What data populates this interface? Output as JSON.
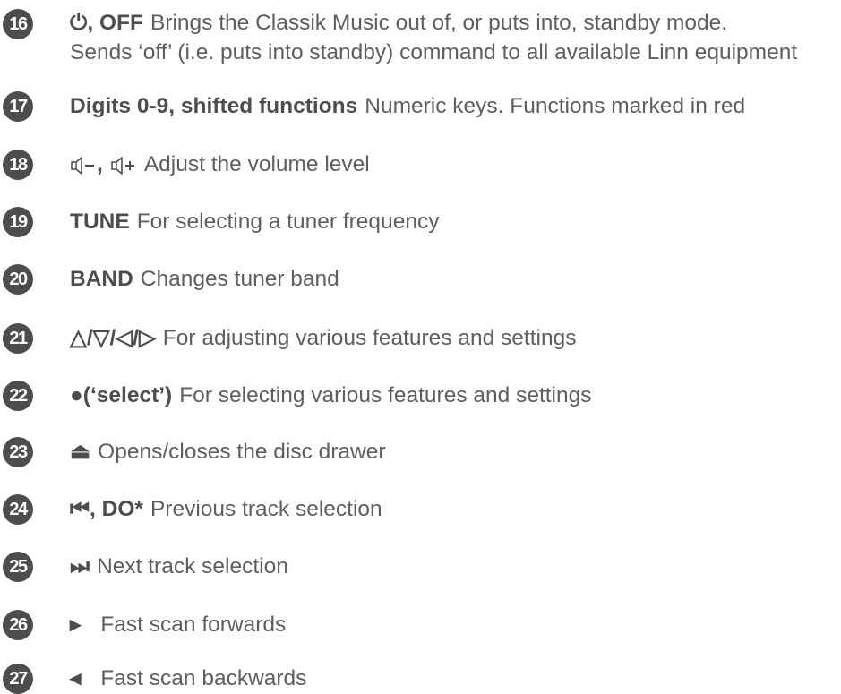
{
  "items": [
    {
      "num": "16",
      "key": "⏻, OFF",
      "desc": "Brings the Classik Music out of, or puts into, standby mode.",
      "desc2": "Sends ‘off’ (i.e. puts into standby) command to all available Linn equipment"
    },
    {
      "num": "17",
      "key": "Digits 0-9, shifted functions",
      "desc": "Numeric keys. Functions marked in red"
    },
    {
      "num": "18",
      "key_sep": ",",
      "desc": "Adjust the volume level"
    },
    {
      "num": "19",
      "key": "TUNE",
      "desc": "For selecting a tuner frequency"
    },
    {
      "num": "20",
      "key": "BAND",
      "desc": "Changes tuner band"
    },
    {
      "num": "21",
      "key": "△/▽/◁/▷",
      "desc": "For adjusting various features and settings"
    },
    {
      "num": "22",
      "key": "●(‘select’)",
      "desc": "For selecting various features and settings"
    },
    {
      "num": "23",
      "key": "⏏",
      "desc": "Opens/closes the disc drawer"
    },
    {
      "num": "24",
      "key": "⏮, DO*",
      "desc": "Previous track selection"
    },
    {
      "num": "25",
      "key": "⏭",
      "desc": "Next track selection"
    },
    {
      "num": "26",
      "key": "▸",
      "desc": "Fast scan forwards"
    },
    {
      "num": "27",
      "key": "◂",
      "desc": "Fast scan backwards"
    }
  ]
}
